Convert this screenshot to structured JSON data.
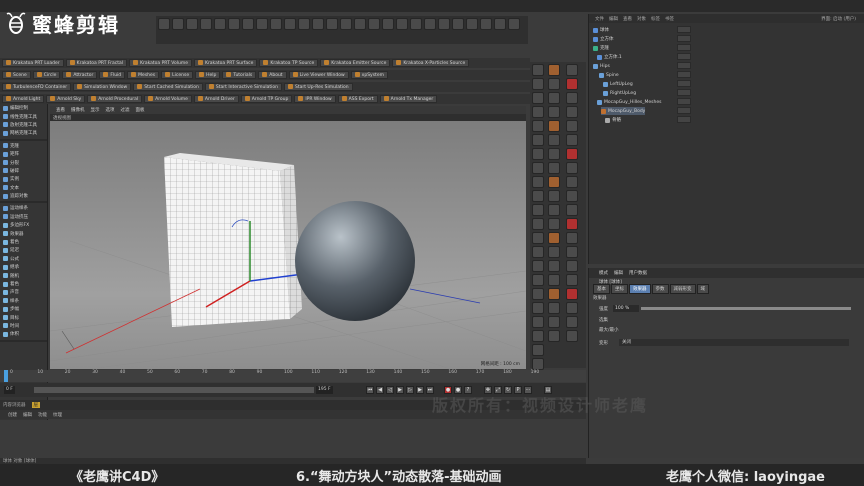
{
  "brand": {
    "name": "蜜蜂剪辑",
    "logo_icon": "bee-logo-icon"
  },
  "toolbar_plugins_1": [
    "Krakatoa PRT Loader",
    "Krakatoa PRT Fractal",
    "Krakatoa PRT Volume",
    "Krakatoa PRT Surface",
    "Krakatoa TP Source",
    "Krakatoa Emitter Source",
    "Krakatoa X-Particles Source"
  ],
  "toolbar_plugins_2": [
    "Scene",
    "Circle",
    "Attractor",
    "Fluid",
    "Meshes",
    "License",
    "Help",
    "Tutorials",
    "About",
    "Live Viewer Window",
    "xpSystem"
  ],
  "toolbar_plugins_3": [
    "TurbulenceFD Container",
    "Simulation Window",
    "Start Cached Simulation",
    "Start Interactive Simulation",
    "Start Up-Res Simulation"
  ],
  "toolbar_plugins_4": [
    "Arnold Light",
    "Arnold Sky",
    "Arnold Procedural",
    "Arnold Volume",
    "Arnold Driver",
    "Arnold TP Group",
    "IPR Window",
    "ASS Export",
    "Arnold Tx Manager"
  ],
  "left_panel": {
    "items": [
      "编辑控制",
      "线性克隆工具",
      "放射克隆工具",
      "网格克隆工具",
      "克隆",
      "矩阵",
      "分裂",
      "破碎",
      "实例",
      "文本",
      "追踪对象",
      "运动样条",
      "运动挤压",
      "多边形FX",
      "效果器",
      "着色",
      "延迟",
      "公式",
      "继承",
      "随机",
      "着色",
      "声音",
      "样条",
      "步幅",
      "目标",
      "时间",
      "体积"
    ]
  },
  "viewport": {
    "menu": [
      "查看",
      "摄像机",
      "显示",
      "选项",
      "过滤",
      "面板"
    ],
    "header": "透视视图",
    "grid_info": "网格间距 : 100 cm"
  },
  "timeline": {
    "ticks": [
      "0",
      "10",
      "20",
      "30",
      "40",
      "50",
      "60",
      "70",
      "80",
      "90",
      "100",
      "110",
      "120",
      "130",
      "140",
      "150",
      "160",
      "170",
      "180",
      "190"
    ],
    "frame_start": "0 F",
    "frame_end": "195 F",
    "current_frame": "0 F",
    "max_frame": "195 F"
  },
  "material_panel": {
    "tabs": [
      "内容浏览器",
      "层"
    ],
    "menu": [
      "创建",
      "编辑",
      "功能",
      "纹理"
    ],
    "status": "球体 对象 [球体]"
  },
  "object_manager": {
    "menu": [
      "文件",
      "编辑",
      "查看",
      "对象",
      "标签",
      "书签"
    ],
    "items": [
      "球体",
      "立方体",
      "克隆",
      "立方体.1",
      "Hips",
      "Spine",
      "LeftUpLeg",
      "RightUpLeg",
      "MocapGuy_Hilles_Meshes",
      "MocapGuy_Body",
      "骨骼"
    ],
    "layout_label": "界面: 启动 (用户)"
  },
  "attribute_manager": {
    "menu": [
      "模式",
      "编辑",
      "用户数据"
    ],
    "object_label": "球体 [球体]",
    "tabs": [
      "基本",
      "坐标",
      "效果器",
      "参数",
      "减弱形变",
      "域"
    ],
    "section": "效果器",
    "strength_label": "强度",
    "strength_value": "100 %",
    "selection_label": "选集",
    "minmax_label": "最大/最小",
    "deform_label": "变形",
    "deform_value": "关闭"
  },
  "watermark": "版权所有：视频设计师老鹰",
  "caption": {
    "left": "《老鹰讲C4D》",
    "middle": "6.“舞动方块人”动态散落-基础动画",
    "right": "老鹰个人微信: laoyingae"
  }
}
